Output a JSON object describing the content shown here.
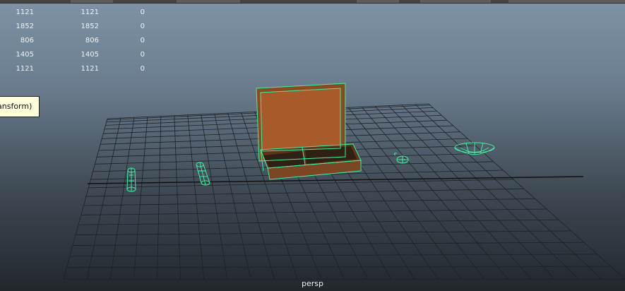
{
  "hud": {
    "rows": [
      {
        "a": "1121",
        "b": "1121",
        "c": "0"
      },
      {
        "a": "1852",
        "b": "1852",
        "c": "0"
      },
      {
        "a": "806",
        "b": "806",
        "c": "0"
      },
      {
        "a": "1405",
        "b": "1405",
        "c": "0"
      },
      {
        "a": "1121",
        "b": "1121",
        "c": "0"
      }
    ]
  },
  "tooltip": {
    "text": "ansform)"
  },
  "viewport": {
    "camera": "persp",
    "wireframe_color": "#3ff0a0",
    "grid_color": "#1c2126"
  },
  "objects": [
    {
      "name": "box",
      "selected": true
    },
    {
      "name": "cylinder-left"
    },
    {
      "name": "cylinder-mid"
    },
    {
      "name": "small-object"
    },
    {
      "name": "bowl"
    }
  ]
}
